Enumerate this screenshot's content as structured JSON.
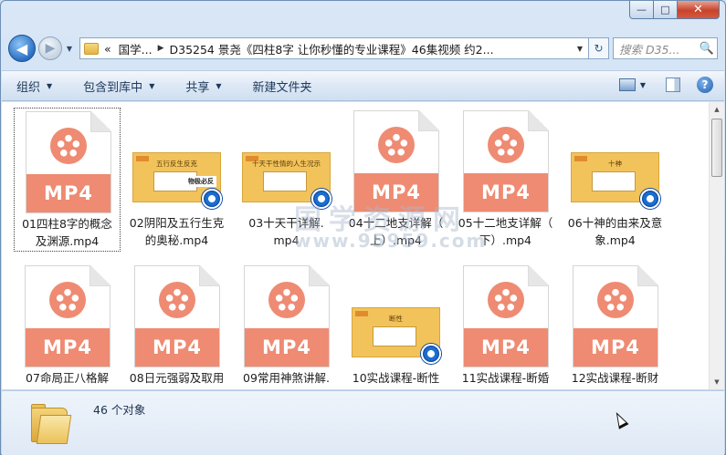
{
  "window": {
    "minimize": "—",
    "maximize": "□",
    "close": "✕"
  },
  "nav": {
    "back_icon": "◀",
    "forward_icon": "▶",
    "history_dropdown": "▼"
  },
  "address": {
    "prefix": "«",
    "segment1": "国学...",
    "separator": "▶",
    "path": "D35254 景尧《四柱8字 让你秒懂的专业课程》46集视频 约2...",
    "dropdown": "▼",
    "refresh_icon": "↻"
  },
  "search": {
    "placeholder": "搜索 D35...",
    "icon": "🔍"
  },
  "commands": {
    "organize": "组织",
    "include_library": "包含到库中",
    "share": "共享",
    "new_folder": "新建文件夹",
    "dropdown": "▼",
    "help": "?"
  },
  "files": [
    {
      "name_line1": "01四柱8字的概念",
      "name_line2": "及渊源.mp4",
      "type": "mp4",
      "badge": "MP4",
      "selected": true
    },
    {
      "name_line1": "02阴阳及五行生克",
      "name_line2": "的奥秘.mp4",
      "type": "image",
      "thumb_title": "五行反生反克",
      "thumb_tag": "物极必反"
    },
    {
      "name_line1": "03十天干详解.",
      "name_line2": "mp4",
      "type": "image",
      "thumb_title": "十天干性情的人生况示"
    },
    {
      "name_line1": "04十二地支详解（",
      "name_line2": "上）.mp4",
      "type": "mp4",
      "badge": "MP4"
    },
    {
      "name_line1": "05十二地支详解（",
      "name_line2": "下）.mp4",
      "type": "mp4",
      "badge": "MP4"
    },
    {
      "name_line1": "06十神的由来及意",
      "name_line2": "象.mp4",
      "type": "image",
      "thumb_title": "十神"
    },
    {
      "name_line1": "07命局正八格解",
      "name_line2": "",
      "type": "mp4",
      "badge": "MP4"
    },
    {
      "name_line1": "08日元强弱及取用",
      "name_line2": "",
      "type": "mp4",
      "badge": "MP4"
    },
    {
      "name_line1": "09常用神煞讲解.",
      "name_line2": "",
      "type": "mp4",
      "badge": "MP4"
    },
    {
      "name_line1": "10实战课程-断性",
      "name_line2": "",
      "type": "image",
      "thumb_title": "断性"
    },
    {
      "name_line1": "11实战课程-断婚",
      "name_line2": "",
      "type": "mp4",
      "badge": "MP4"
    },
    {
      "name_line1": "12实战课程-断财",
      "name_line2": "",
      "type": "mp4",
      "badge": "MP4"
    }
  ],
  "watermark": {
    "line1": "国学资源网",
    "line2": "www.95959.com"
  },
  "details": {
    "count": "46 个对象"
  }
}
